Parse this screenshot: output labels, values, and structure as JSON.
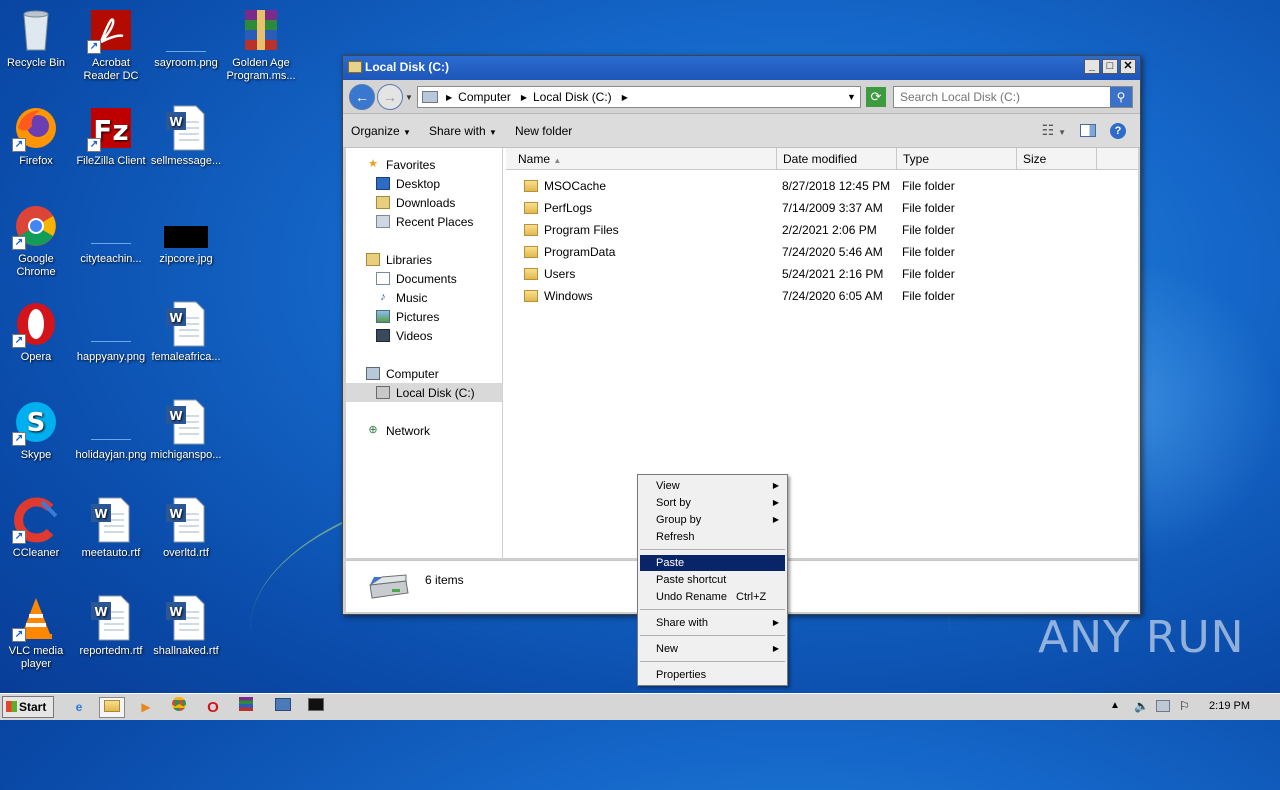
{
  "desktop": {
    "icons": [
      {
        "label": "Recycle Bin",
        "icon": "recycle-bin-icon"
      },
      {
        "label": "Acrobat Reader DC",
        "icon": "acrobat-icon"
      },
      {
        "label": "sayroom.png",
        "icon": "image-file-icon"
      },
      {
        "label": "Golden Age Program.ms...",
        "icon": "winrar-icon"
      },
      {
        "label": "Firefox",
        "icon": "firefox-icon"
      },
      {
        "label": "FileZilla Client",
        "icon": "filezilla-icon"
      },
      {
        "label": "sellmessage...",
        "icon": "word-doc-icon"
      },
      {
        "label": "Google Chrome",
        "icon": "chrome-icon"
      },
      {
        "label": "cityteachin...",
        "icon": "image-file-icon"
      },
      {
        "label": "zipcore.jpg",
        "icon": "image-file-icon"
      },
      {
        "label": "Opera",
        "icon": "opera-icon"
      },
      {
        "label": "happyany.png",
        "icon": "image-file-icon"
      },
      {
        "label": "femaleafrica...",
        "icon": "word-doc-icon"
      },
      {
        "label": "Skype",
        "icon": "skype-icon"
      },
      {
        "label": "holidayjan.png",
        "icon": "image-file-icon"
      },
      {
        "label": "michiganspo...",
        "icon": "word-doc-icon"
      },
      {
        "label": "CCleaner",
        "icon": "ccleaner-icon"
      },
      {
        "label": "meetauto.rtf",
        "icon": "word-doc-icon"
      },
      {
        "label": "overltd.rtf",
        "icon": "word-doc-icon"
      },
      {
        "label": "VLC media player",
        "icon": "vlc-icon"
      },
      {
        "label": "reportedm.rtf",
        "icon": "word-doc-icon"
      },
      {
        "label": "shallnaked.rtf",
        "icon": "word-doc-icon"
      }
    ]
  },
  "window": {
    "title": "Local Disk (C:)",
    "minimize": "_",
    "maximize": "□",
    "close": "✕",
    "breadcrumb": [
      "Computer",
      "Local Disk (C:)"
    ],
    "search_placeholder": "Search Local Disk (C:)",
    "toolbar": {
      "organize": "Organize",
      "share_with": "Share with",
      "new_folder": "New folder"
    },
    "nav": {
      "favorites": "Favorites",
      "desktop": "Desktop",
      "downloads": "Downloads",
      "recent_places": "Recent Places",
      "libraries": "Libraries",
      "documents": "Documents",
      "music": "Music",
      "pictures": "Pictures",
      "videos": "Videos",
      "computer": "Computer",
      "local_disk": "Local Disk (C:)",
      "network": "Network"
    },
    "columns": {
      "name": "Name",
      "date_modified": "Date modified",
      "type": "Type",
      "size": "Size"
    },
    "files": [
      {
        "name": "MSOCache",
        "date": "8/27/2018 12:45 PM",
        "type": "File folder"
      },
      {
        "name": "PerfLogs",
        "date": "7/14/2009 3:37 AM",
        "type": "File folder"
      },
      {
        "name": "Program Files",
        "date": "2/2/2021 2:06 PM",
        "type": "File folder"
      },
      {
        "name": "ProgramData",
        "date": "7/24/2020 5:46 AM",
        "type": "File folder"
      },
      {
        "name": "Users",
        "date": "5/24/2021 2:16 PM",
        "type": "File folder"
      },
      {
        "name": "Windows",
        "date": "7/24/2020 6:05 AM",
        "type": "File folder"
      }
    ],
    "status": "6 items"
  },
  "context_menu": {
    "view": "View",
    "sort_by": "Sort by",
    "group_by": "Group by",
    "refresh": "Refresh",
    "paste": "Paste",
    "paste_shortcut": "Paste shortcut",
    "undo_rename": "Undo Rename",
    "undo_shortcut": "Ctrl+Z",
    "share_with": "Share with",
    "new": "New",
    "properties": "Properties"
  },
  "taskbar": {
    "start": "Start",
    "clock": "2:19 PM"
  },
  "watermark": "ANY RUN"
}
